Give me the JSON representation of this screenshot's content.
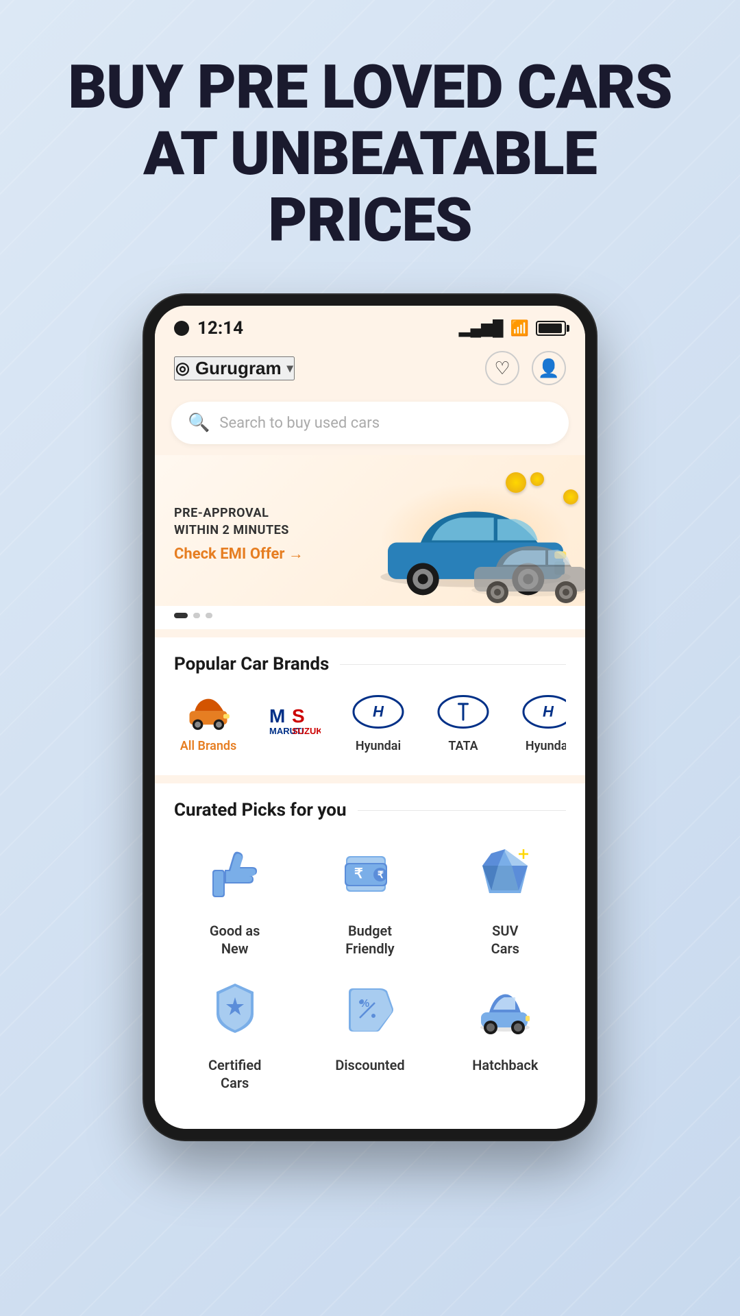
{
  "hero": {
    "title_line1": "BUY PRE LOVED CARS",
    "title_line2": "AT UNBEATABLE PRICES"
  },
  "phone": {
    "status_bar": {
      "time": "12:14"
    },
    "header": {
      "location": "Gurugram",
      "heart_label": "wishlist",
      "profile_label": "profile"
    },
    "search": {
      "placeholder": "Search to buy used cars"
    },
    "banner": {
      "pre_approval_line1": "PRE-APPROVAL",
      "pre_approval_line2": "WITHIN 2 MINUTES",
      "emi_link": "Check EMI Offer →"
    },
    "popular_brands": {
      "section_title": "Popular Car Brands",
      "brands": [
        {
          "label": "All Brands",
          "type": "all"
        },
        {
          "label": "Maruti\nSuzuki",
          "type": "maruti"
        },
        {
          "label": "Hyundai",
          "type": "hyundai"
        },
        {
          "label": "TATA",
          "type": "tata"
        },
        {
          "label": "Hyundai",
          "type": "hyundai2"
        }
      ]
    },
    "curated_picks": {
      "section_title": "Curated Picks for you",
      "items": [
        {
          "label": "Good as New",
          "type": "good-as-new"
        },
        {
          "label": "Budget Friendly",
          "type": "budget-friendly"
        },
        {
          "label": "SUV Cars",
          "type": "suv-cars"
        },
        {
          "label": "Certified Cars",
          "type": "certified"
        },
        {
          "label": "Discounted",
          "type": "discounted"
        },
        {
          "label": "Hatchback",
          "type": "hatchback"
        }
      ]
    }
  }
}
